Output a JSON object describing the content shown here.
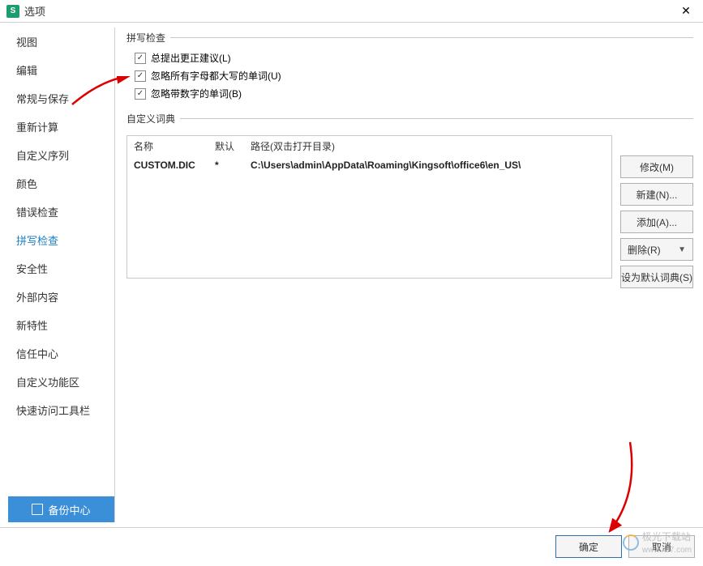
{
  "titlebar": {
    "icon_letter": "S",
    "title": "选项"
  },
  "sidebar": {
    "items": [
      {
        "label": "视图"
      },
      {
        "label": "编辑"
      },
      {
        "label": "常规与保存"
      },
      {
        "label": "重新计算"
      },
      {
        "label": "自定义序列"
      },
      {
        "label": "颜色"
      },
      {
        "label": "错误检查"
      },
      {
        "label": "拼写检查"
      },
      {
        "label": "安全性"
      },
      {
        "label": "外部内容"
      },
      {
        "label": "新特性"
      },
      {
        "label": "信任中心"
      },
      {
        "label": "自定义功能区"
      },
      {
        "label": "快速访问工具栏"
      }
    ],
    "active_index": 7,
    "backup_label": "备份中心"
  },
  "content": {
    "group1_label": "拼写检查",
    "checks": [
      {
        "label": "总提出更正建议(L)",
        "checked": true
      },
      {
        "label": "忽略所有字母都大写的单词(U)",
        "checked": true
      },
      {
        "label": "忽略带数字的单词(B)",
        "checked": true
      }
    ],
    "group2_label": "自定义词典",
    "table": {
      "headers": {
        "name": "名称",
        "def": "默认",
        "path": "路径(双击打开目录)"
      },
      "row": {
        "name": "CUSTOM.DIC",
        "def": "*",
        "path": "C:\\Users\\admin\\AppData\\Roaming\\Kingsoft\\office6\\en_US\\"
      }
    },
    "sidebuttons": {
      "modify": "修改(M)",
      "new": "新建(N)...",
      "add": "添加(A)...",
      "delete": "删除(R)",
      "setdefault": "设为默认词典(S)"
    }
  },
  "footer": {
    "ok": "确定",
    "cancel": "取消"
  },
  "watermark": {
    "text": "极光下载站",
    "url": "www.xz7.com"
  }
}
